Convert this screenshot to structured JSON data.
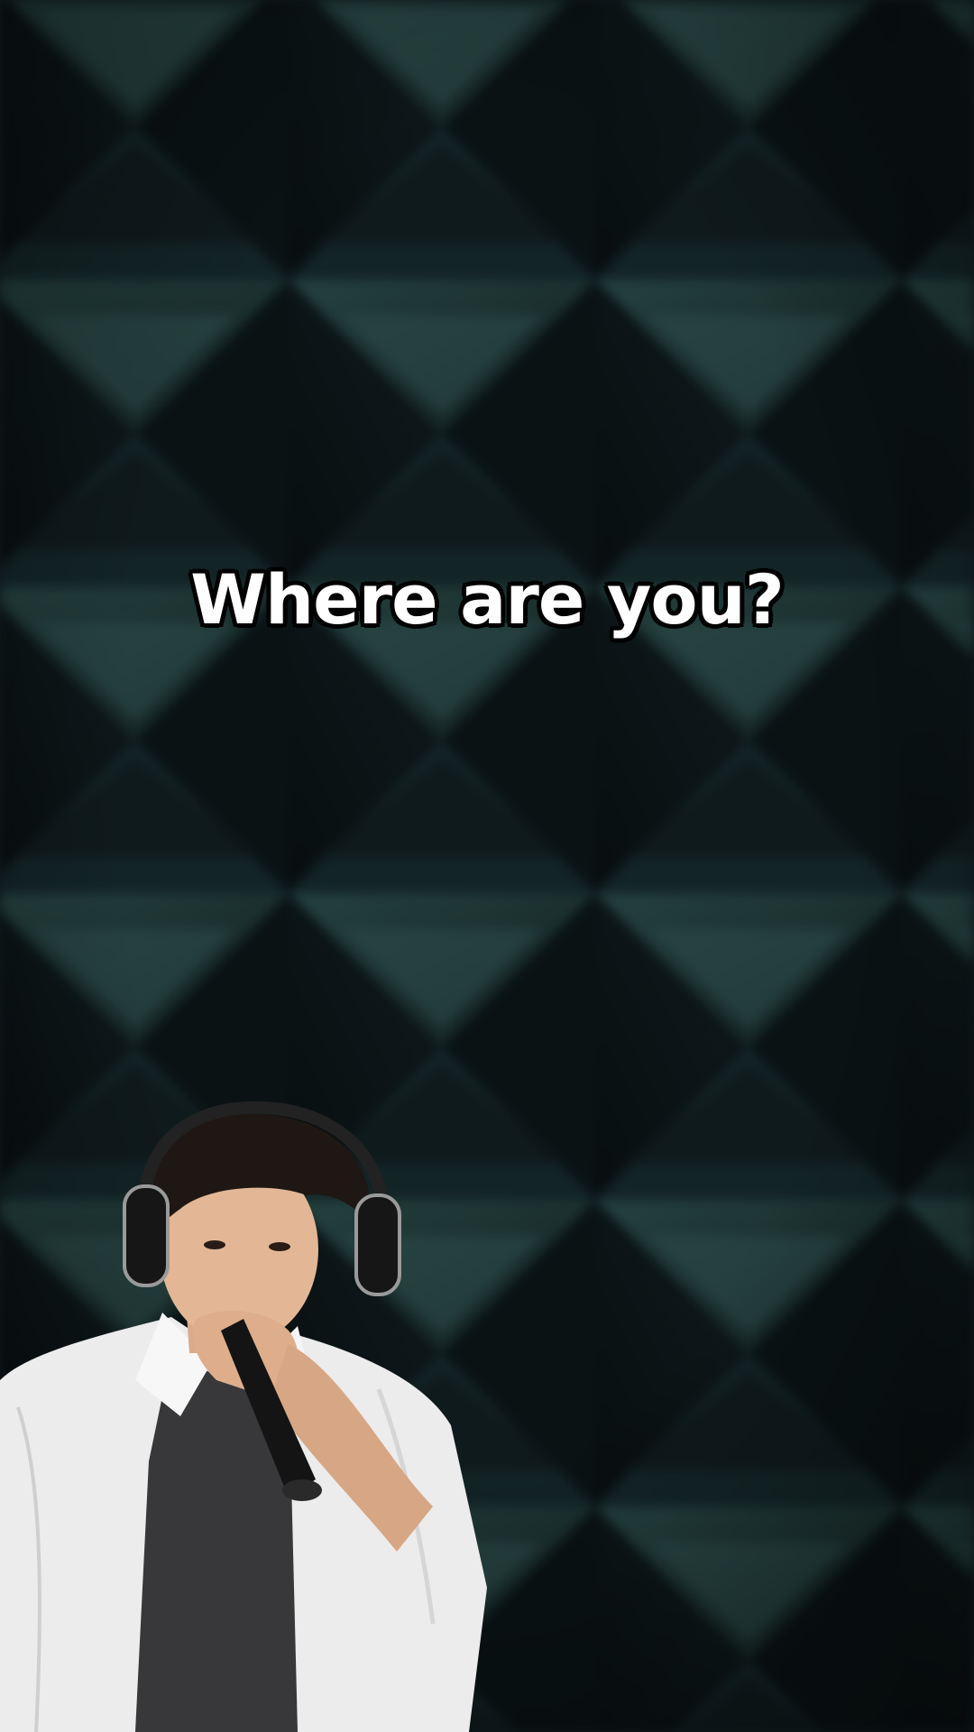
{
  "caption": {
    "text": "Where are you?"
  },
  "scene": {
    "background": "acoustic-foam-wall",
    "subject": "person-with-headphones-and-microphone"
  },
  "colors": {
    "wall_dark": "#0b1214",
    "wall_light": "#1f3a3d",
    "caption_fill": "#ffffff",
    "caption_outline": "#000000",
    "shirt": "#eeeeee",
    "tee": "#3a3a3c",
    "hair": "#1e1714"
  }
}
